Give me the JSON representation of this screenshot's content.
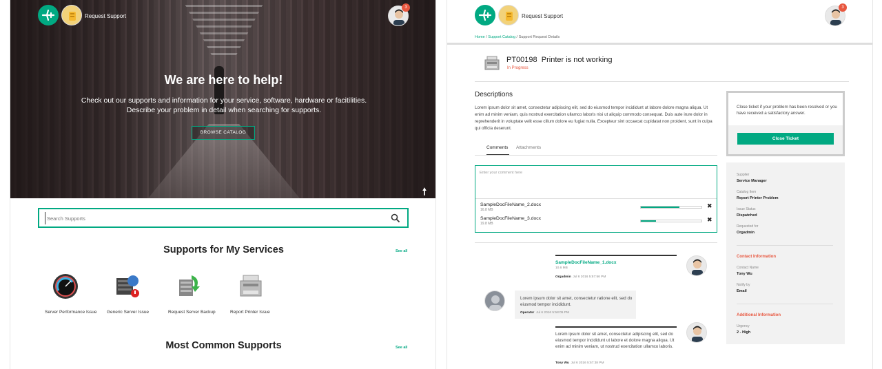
{
  "colors": {
    "accent": "#01a982",
    "danger": "#e8573f"
  },
  "left": {
    "header": {
      "title": "Request Support",
      "notification_count": "3"
    },
    "hero": {
      "heading": "We are here to help!",
      "line1": "Check out our supports and information for your service, software, hardware or facitilities.",
      "line2": "Describe your problem in detail when searching for supports.",
      "browse_label": "BROWSE CATALOG"
    },
    "search": {
      "placeholder": "Search Supports"
    },
    "services": {
      "title": "Supports for My Services",
      "see_all": "See all",
      "items": [
        {
          "label": "Server Performance Issue",
          "icon": "gauge-icon"
        },
        {
          "label": "Generic Server Issue",
          "icon": "server-alert-icon"
        },
        {
          "label": "Request Server Backup",
          "icon": "server-backup-icon"
        },
        {
          "label": "Report Printer Issue",
          "icon": "printer-icon"
        }
      ]
    },
    "common": {
      "title": "Most Common Supports",
      "see_all": "See all"
    }
  },
  "right": {
    "header": {
      "title": "Request Support",
      "notification_count": "3"
    },
    "breadcrumb": {
      "home": "Home",
      "catalog": "Support Catalog",
      "current": "Support Request Details"
    },
    "ticket": {
      "id": "PT00198",
      "title": "Printer is not working",
      "status": "In Progress"
    },
    "descriptions": {
      "title": "Descriptions",
      "text": "Lorem ipsum dolor sit amet, consectetur adipiscing elit, sed do eiusmod tempor incididunt ut labore dolore magna aliqua. Ut enim ad minim veniam, quis nostrud exercitation ullamco laboris nisi ut aliquip commodo consequat. Duis aute irure dolor in reprehenderit in voluptate velit esse cillum dolore eu fugiat nulla. Excepteur sint occaecat cupidatat non proident, sunt in culpa qui officia deserunt."
    },
    "tabs": {
      "comments": "Comments",
      "attachments": "Attachments"
    },
    "comment_box": {
      "placeholder": "Enter your comment here",
      "files": [
        {
          "name": "SampleDocFileName_2.docx",
          "size": "16.8 MB",
          "progress": 0.64
        },
        {
          "name": "SampleDocFileName_3.docx",
          "size": "19.8 MB",
          "progress": 0.25
        }
      ]
    },
    "messages": [
      {
        "file": "SampleDocFileName_1.docx",
        "size": "10.6 MB",
        "author": "Orgadmin",
        "time": "Jul 6 2016 5:57:56 PM"
      },
      {
        "text": "Lorem ipsum dolor sit amet, consectetur ratione elit, sed do eiusmod tempor incididunt.",
        "author": "Operator",
        "time": "Jul 6 2016 5:58:05 PM"
      },
      {
        "text": "Lorem ipsum dolor sit amet, consectetur adipiscing elit, sed do eiusmod tempor incididunt ut labore et dolore magna aliqua. Ut enim ad minim veniam, ut nostrud exercitation ullamco laboris.",
        "author": "Tony Wu",
        "time": "Jul 6 2016 5:57:38 PM"
      }
    ],
    "close_panel": {
      "text": "Close ticket if your problem has been resolved or you have received a satisfactory answer.",
      "button": "Close Ticket"
    },
    "info": {
      "supplier_k": "Supplier",
      "supplier_v": "Service Manager",
      "catalog_k": "Catalog Item",
      "catalog_v": "Report Printer Problem",
      "status_k": "Issue Status",
      "status_v": "Dispatched",
      "requested_k": "Requested for",
      "requested_v": "Orgadmin",
      "contact_h": "Contact Information",
      "contact_name_k": "Contact Name",
      "contact_name_v": "Tony Wu",
      "notify_k": "Notify by",
      "notify_v": "Email",
      "additional_h": "Additional Information",
      "urgency_k": "Urgency",
      "urgency_v": "2 - High"
    }
  }
}
